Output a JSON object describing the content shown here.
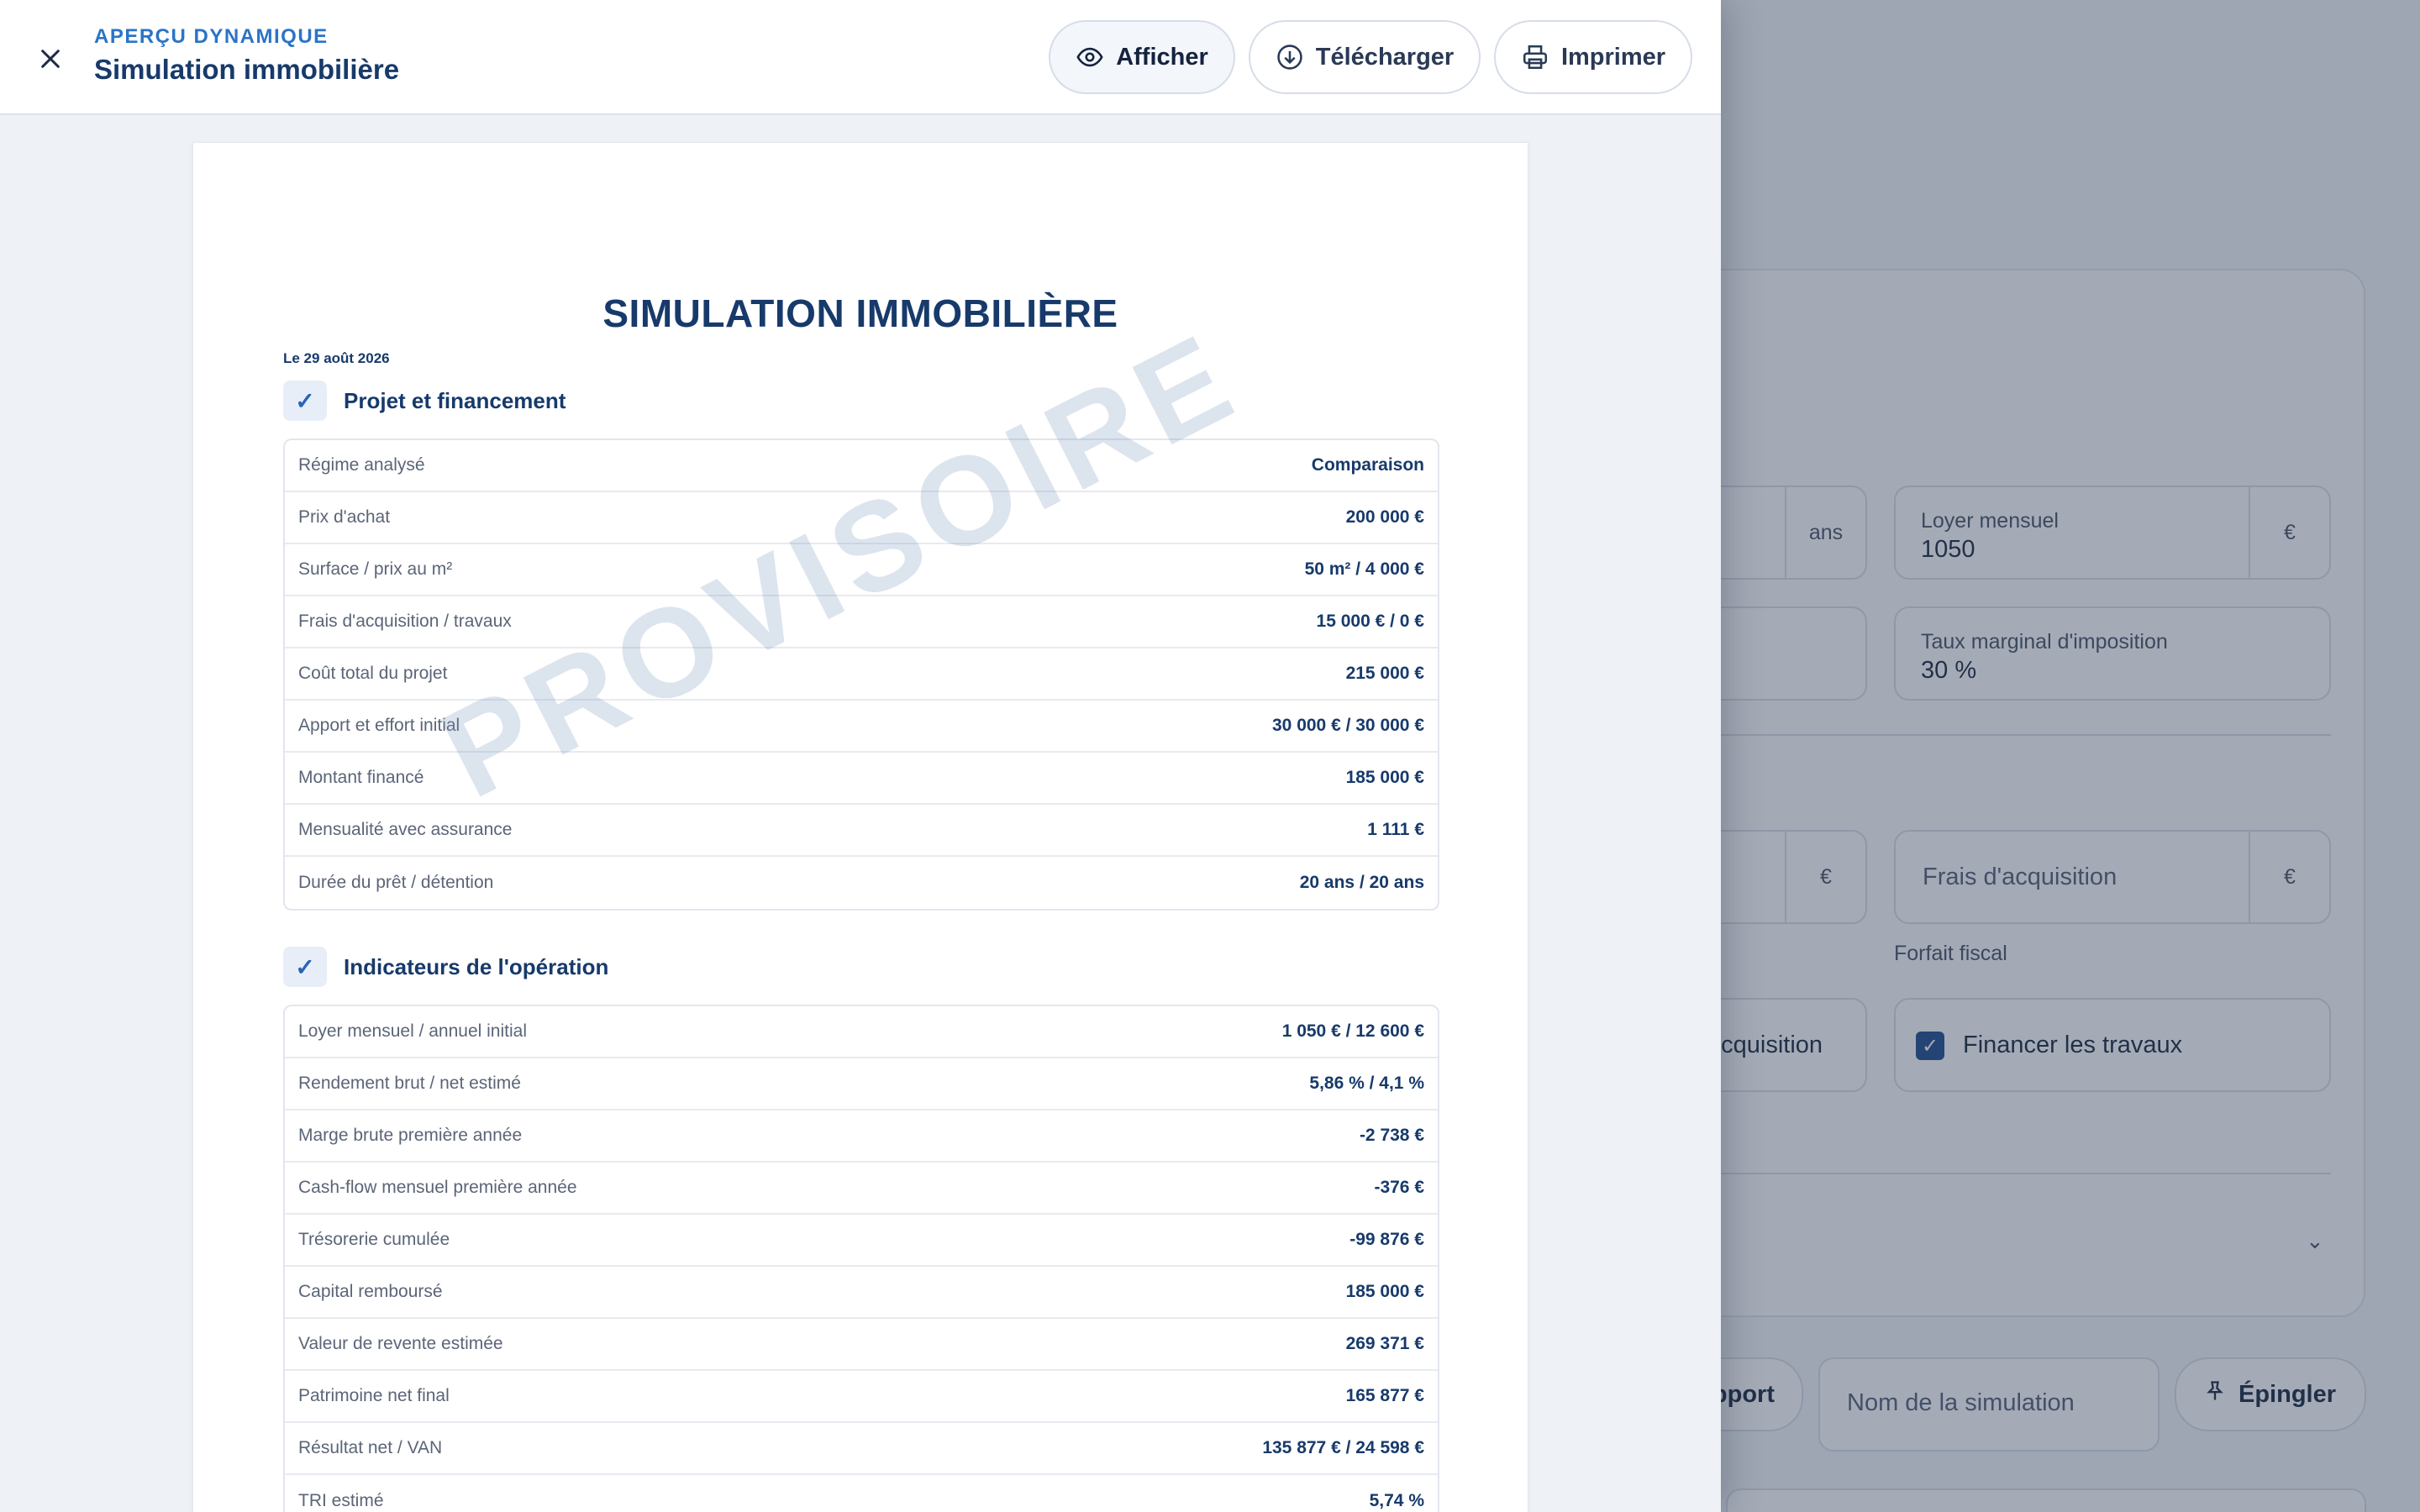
{
  "background": {
    "fields": {
      "years_unit": "ans",
      "loyer_label": "Loyer mensuel",
      "loyer_value": "1050",
      "loyer_unit": "€",
      "tmi_label": "Taux marginal d'imposition",
      "tmi_value": "30 %",
      "amount_unit": "€",
      "frais_placeholder": "Frais d'acquisition",
      "frais_unit": "€",
      "frais_hint": "Forfait fiscal",
      "acquisition_partial": "acquisition",
      "financer_travaux": "Financer les travaux",
      "rapport_partial": "pport",
      "simulation_name_placeholder": "Nom de la simulation",
      "pin_label": "Épingler"
    }
  },
  "panel": {
    "kicker": "APERÇU DYNAMIQUE",
    "title": "Simulation immobilière",
    "buttons": {
      "show": "Afficher",
      "download": "Télécharger",
      "print": "Imprimer"
    }
  },
  "document": {
    "title": "SIMULATION IMMOBILIÈRE",
    "date": "Le 29 août 2026",
    "watermark": "PROVISOIRE",
    "sections": [
      {
        "title": "Projet et financement",
        "rows": [
          {
            "label": "Régime analysé",
            "value": "Comparaison"
          },
          {
            "label": "Prix d'achat",
            "value": "200 000 €"
          },
          {
            "label": "Surface / prix au m²",
            "value": "50 m² / 4 000 €"
          },
          {
            "label": "Frais d'acquisition / travaux",
            "value": "15 000 € / 0 €"
          },
          {
            "label": "Coût total du projet",
            "value": "215 000 €"
          },
          {
            "label": "Apport et effort initial",
            "value": "30 000 € / 30 000 €"
          },
          {
            "label": "Montant financé",
            "value": "185 000 €"
          },
          {
            "label": "Mensualité avec assurance",
            "value": "1 111 €"
          },
          {
            "label": "Durée du prêt / détention",
            "value": "20 ans / 20 ans"
          }
        ]
      },
      {
        "title": "Indicateurs de l'opération",
        "rows": [
          {
            "label": "Loyer mensuel / annuel initial",
            "value": "1 050 € / 12 600 €"
          },
          {
            "label": "Rendement brut / net estimé",
            "value": "5,86 % / 4,1 %"
          },
          {
            "label": "Marge brute première année",
            "value": "-2 738 €"
          },
          {
            "label": "Cash-flow mensuel première année",
            "value": "-376 €"
          },
          {
            "label": "Trésorerie cumulée",
            "value": "-99 876 €"
          },
          {
            "label": "Capital remboursé",
            "value": "185 000 €"
          },
          {
            "label": "Valeur de revente estimée",
            "value": "269 371 €"
          },
          {
            "label": "Patrimoine net final",
            "value": "165 877 €"
          },
          {
            "label": "Résultat net / VAN",
            "value": "135 877 € / 24 598 €"
          },
          {
            "label": "TRI estimé",
            "value": "5,74 %"
          }
        ]
      }
    ]
  }
}
